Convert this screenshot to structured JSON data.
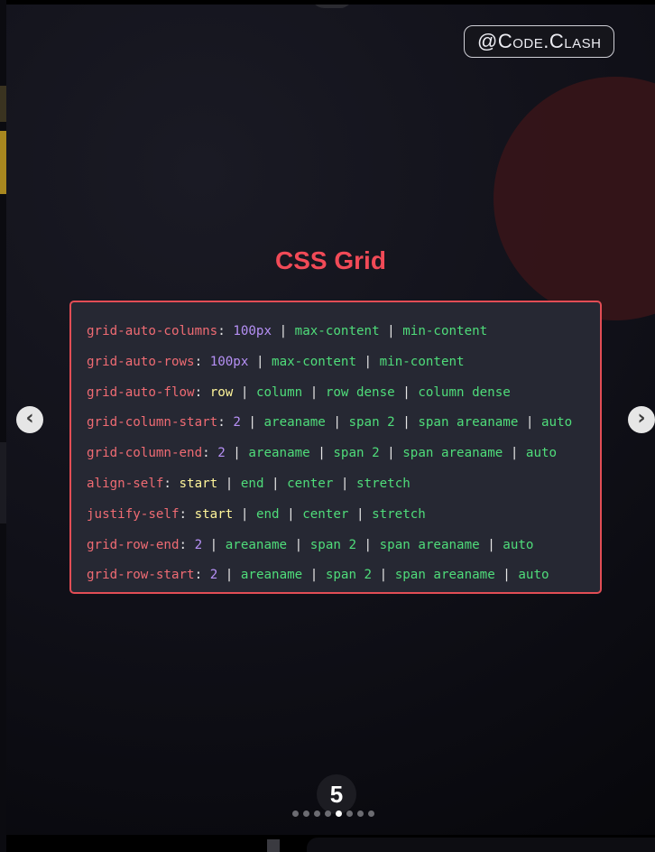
{
  "account_handle": "@Code.Clash",
  "slide_title": "CSS Grid",
  "code_lines": [
    {
      "prop": "grid-auto-columns",
      "tokens": [
        {
          "t": "100px",
          "k": "num"
        },
        {
          "t": "max-content",
          "k": "opt"
        },
        {
          "t": "min-content",
          "k": "opt"
        }
      ]
    },
    {
      "prop": "grid-auto-rows",
      "tokens": [
        {
          "t": "100px",
          "k": "num"
        },
        {
          "t": "max-content",
          "k": "opt"
        },
        {
          "t": "min-content",
          "k": "opt"
        }
      ]
    },
    {
      "prop": "grid-auto-flow",
      "tokens": [
        {
          "t": "row",
          "k": "kw"
        },
        {
          "t": "column",
          "k": "opt"
        },
        {
          "t": "row dense",
          "k": "opt"
        },
        {
          "t": "column dense",
          "k": "opt"
        }
      ]
    },
    {
      "prop": "grid-column-start",
      "tokens": [
        {
          "t": "2",
          "k": "num"
        },
        {
          "t": "areaname",
          "k": "opt"
        },
        {
          "t": "span 2",
          "k": "opt"
        },
        {
          "t": "span areaname",
          "k": "opt"
        },
        {
          "t": "auto",
          "k": "opt"
        }
      ]
    },
    {
      "prop": "grid-column-end",
      "tokens": [
        {
          "t": "2",
          "k": "num"
        },
        {
          "t": "areaname",
          "k": "opt"
        },
        {
          "t": "span 2",
          "k": "opt"
        },
        {
          "t": "span areaname",
          "k": "opt"
        },
        {
          "t": "auto",
          "k": "opt"
        }
      ]
    },
    {
      "prop": "align-self",
      "tokens": [
        {
          "t": "start",
          "k": "kw"
        },
        {
          "t": "end",
          "k": "opt"
        },
        {
          "t": "center",
          "k": "opt"
        },
        {
          "t": "stretch",
          "k": "opt"
        }
      ]
    },
    {
      "prop": "justify-self",
      "tokens": [
        {
          "t": "start",
          "k": "kw"
        },
        {
          "t": "end",
          "k": "opt"
        },
        {
          "t": "center",
          "k": "opt"
        },
        {
          "t": "stretch",
          "k": "opt"
        }
      ]
    },
    {
      "prop": "grid-row-end",
      "tokens": [
        {
          "t": "2",
          "k": "num"
        },
        {
          "t": "areaname",
          "k": "opt"
        },
        {
          "t": "span 2",
          "k": "opt"
        },
        {
          "t": "span areaname",
          "k": "opt"
        },
        {
          "t": "auto",
          "k": "opt"
        }
      ]
    },
    {
      "prop": "grid-row-start",
      "tokens": [
        {
          "t": "2",
          "k": "num"
        },
        {
          "t": "areaname",
          "k": "opt"
        },
        {
          "t": "span 2",
          "k": "opt"
        },
        {
          "t": "span areaname",
          "k": "opt"
        },
        {
          "t": "auto",
          "k": "opt"
        }
      ]
    }
  ],
  "carousel": {
    "current_page": "5",
    "total_dots": 8,
    "active_dot": 4,
    "prev_icon": "chevron-left-icon",
    "next_icon": "chevron-right-icon"
  },
  "colors": {
    "title": "#f14a57",
    "property": "#ef6b73",
    "number_value": "#b690f5",
    "keyword_value": "#fff59a",
    "option_value": "#4fdc7a",
    "border": "#e24d55"
  }
}
